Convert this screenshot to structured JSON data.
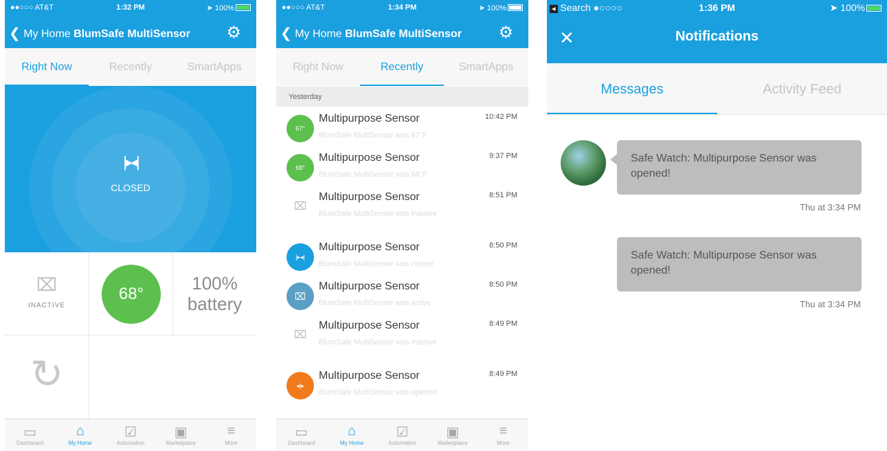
{
  "colors": {
    "brand": "#1a9fdf",
    "green": "#5cbf4e",
    "blue_dot": "#1a9fdf",
    "teal_dot": "#5a9fc4",
    "orange_dot": "#f07a1c"
  },
  "p1": {
    "status": {
      "carrier": "●●○○○ AT&T",
      "time": "1:32 PM",
      "battery": "100%"
    },
    "nav": {
      "back_label": "My Home",
      "title": "BlumSafe MultiSensor"
    },
    "tabs": [
      "Right Now",
      "Recently",
      "SmartApps"
    ],
    "hero_label": "CLOSED",
    "tiles": {
      "motion": "INACTIVE",
      "temperature": "68°",
      "battery_pct": "100%",
      "battery_word": "battery"
    }
  },
  "p2": {
    "status": {
      "carrier": "●●○○○ AT&T",
      "time": "1:34 PM",
      "battery": "100%"
    },
    "nav": {
      "back_label": "My Home",
      "title": "BlumSafe MultiSensor"
    },
    "tabs": [
      "Right Now",
      "Recently",
      "SmartApps"
    ],
    "section": "Yesterday",
    "events": [
      {
        "badge": "67°",
        "title": "Multipurpose Sensor",
        "sub": "BlumSafe MultiSensor was 67°F",
        "time": "10:42 PM"
      },
      {
        "badge": "68°",
        "title": "Multipurpose Sensor",
        "sub": "BlumSafe MultiSensor was 68°F",
        "time": "9:37 PM"
      },
      {
        "badge": "",
        "title": "Multipurpose Sensor",
        "sub": "BlumSafe MultiSensor was inactive",
        "time": "8:51 PM"
      },
      {
        "badge": "",
        "title": "Multipurpose Sensor",
        "sub": "BlumSafe MultiSensor was closed",
        "time": "8:50 PM"
      },
      {
        "badge": "",
        "title": "Multipurpose Sensor",
        "sub": "BlumSafe MultiSensor was active",
        "time": "8:50 PM"
      },
      {
        "badge": "",
        "title": "Multipurpose Sensor",
        "sub": "BlumSafe MultiSensor was inactive",
        "time": "8:49 PM"
      },
      {
        "badge": "",
        "title": "Multipurpose Sensor",
        "sub": "BlumSafe MultiSensor was opened",
        "time": "8:49 PM"
      }
    ]
  },
  "tabbar": [
    "Dashboard",
    "My Home",
    "Automation",
    "Marketplace",
    "More"
  ],
  "p3": {
    "status": {
      "back_app": "Search",
      "signal": "●○○○○",
      "time": "1:36 PM",
      "battery": "100%"
    },
    "title": "Notifications",
    "tabs": [
      "Messages",
      "Activity Feed"
    ],
    "messages": [
      {
        "text": "Safe Watch: Multipurpose Sensor was opened!",
        "time": "Thu at 3:34 PM"
      },
      {
        "text": "Safe Watch: Multipurpose Sensor was opened!",
        "time": "Thu at 3:34 PM"
      }
    ]
  }
}
